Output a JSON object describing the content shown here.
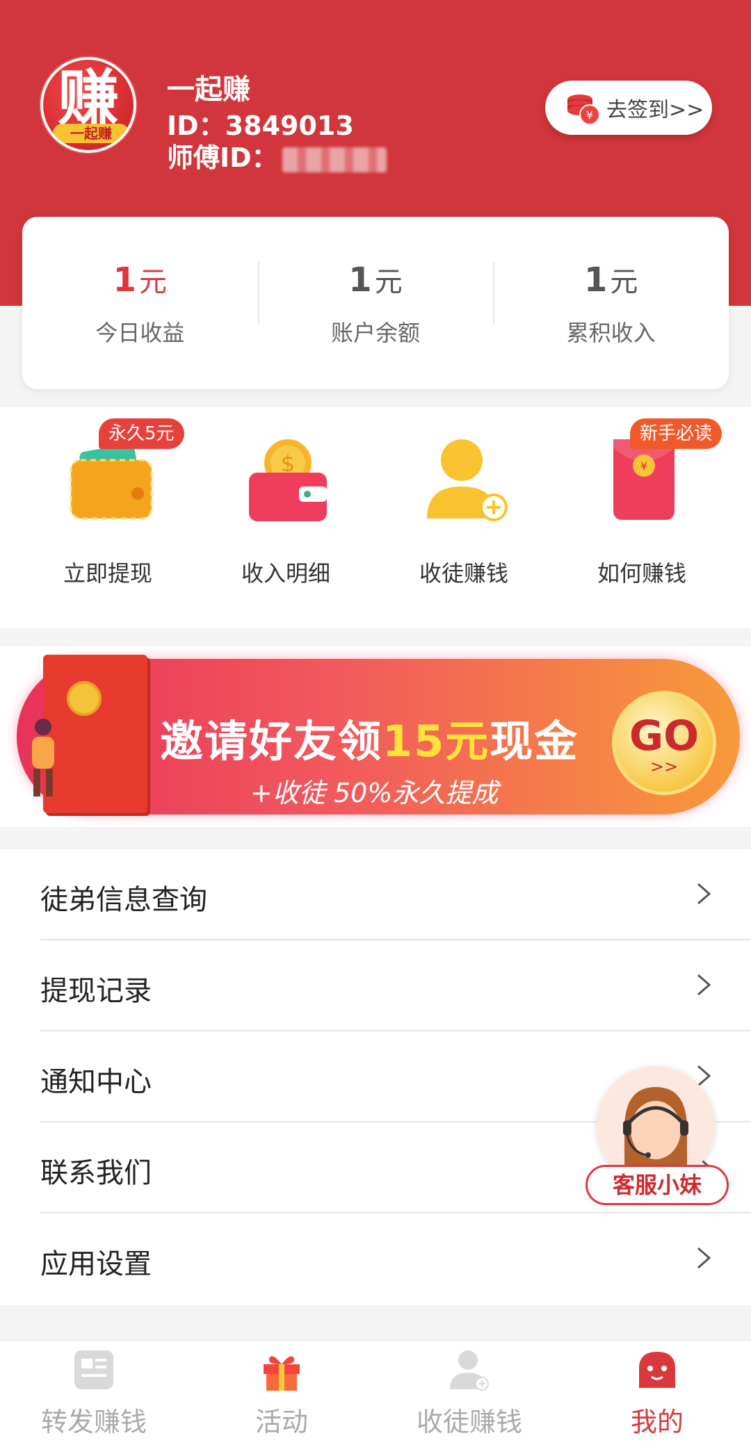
{
  "profile": {
    "avatar_char": "赚",
    "avatar_ribbon": "一起赚",
    "name": "一起赚",
    "id_line": "ID：3849013",
    "master_label": "师傅ID：",
    "signin_label": "去签到>>"
  },
  "stats": [
    {
      "value": "1",
      "unit": "元",
      "label": "今日收益",
      "color": "#d9383c"
    },
    {
      "value": "1",
      "unit": "元",
      "label": "账户余额",
      "color": "#555555"
    },
    {
      "value": "1",
      "unit": "元",
      "label": "累积收入",
      "color": "#555555"
    }
  ],
  "quick_actions": [
    {
      "label": "立即提现",
      "badge": "永久5元",
      "icon": "wallet-icon"
    },
    {
      "label": "收入明细",
      "badge": "",
      "icon": "coin-wallet-icon"
    },
    {
      "label": "收徒赚钱",
      "badge": "",
      "icon": "add-user-icon"
    },
    {
      "label": "如何赚钱",
      "badge": "新手必读",
      "icon": "red-envelope-icon"
    }
  ],
  "banner": {
    "title_pre": "邀请好友领",
    "title_highlight": "15元",
    "title_post": "现金",
    "subtitle": "+收徒 50%永久提成",
    "go": "GO",
    "go_arrows": ">>"
  },
  "menu": [
    {
      "label": "徒弟信息查询"
    },
    {
      "label": "提现记录"
    },
    {
      "label": "通知中心"
    },
    {
      "label": "联系我们"
    },
    {
      "label": "应用设置"
    }
  ],
  "service": {
    "label": "客服小妹"
  },
  "bottom_nav": [
    {
      "label": "转发赚钱",
      "icon": "news-icon",
      "active": false
    },
    {
      "label": "活动",
      "icon": "gift-icon",
      "active": false
    },
    {
      "label": "收徒赚钱",
      "icon": "user-add-icon",
      "active": false
    },
    {
      "label": "我的",
      "icon": "mine-face-icon",
      "active": true
    }
  ],
  "colors": {
    "brand_red": "#d0363b",
    "active_tab": "#d9383c",
    "highlight_yellow": "#ffe33b"
  }
}
